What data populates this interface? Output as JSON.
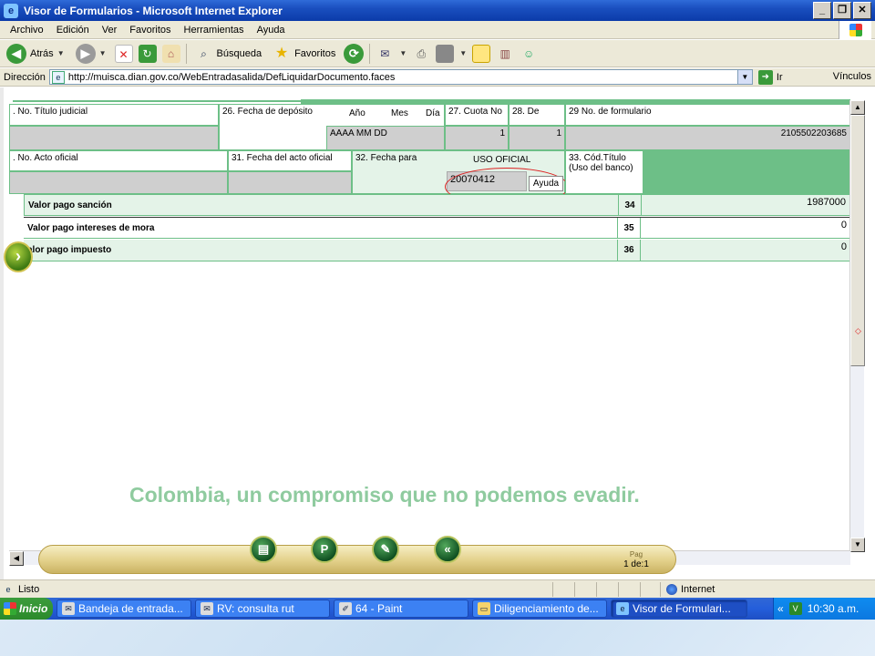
{
  "window": {
    "title": "Visor de Formularios - Microsoft Internet Explorer",
    "buttons": [
      "_",
      "❐",
      "✕"
    ]
  },
  "menu": {
    "items": [
      "Archivo",
      "Edición",
      "Ver",
      "Favoritos",
      "Herramientas",
      "Ayuda"
    ]
  },
  "toolbar": {
    "back_label": "Atrás",
    "search_label": "Búsqueda",
    "favorites_label": "Favoritos"
  },
  "address": {
    "label": "Dirección",
    "url": "http://muisca.dian.gov.co/WebEntradasalida/DefLiquidarDocumento.faces",
    "go_label": "Ir",
    "links_label": "Vínculos"
  },
  "form": {
    "f25_label": ". No. Título judicial",
    "f26_label": "26. Fecha de depósito",
    "year_label": "Año",
    "month_label": "Mes",
    "day_label": "Día",
    "f27_label": "27. Cuota No",
    "f28_label": "28. De",
    "f29_label": "29 No. de formulario",
    "date_format": "AAAA  MM  DD",
    "f27_value": "1",
    "f28_value": "1",
    "f29_value": "2105502203685",
    "f30_label": ". No. Acto oficial",
    "f31_label": "31. Fecha del acto oficial",
    "f32_label": "32. Fecha para",
    "uso_oficial": "USO OFICIAL",
    "f32_value": "20070412",
    "ayuda_label": "Ayuda",
    "f33_label_1": "33. Cód.Título",
    "f33_label_2": "(Uso del banco)"
  },
  "rows": [
    {
      "label": "Valor pago sanción",
      "num": "34",
      "value": "1987000"
    },
    {
      "label": "Valor pago intereses de mora",
      "num": "35",
      "value": "0"
    },
    {
      "label": "alor pago impuesto",
      "num": "36",
      "value": "0"
    }
  ],
  "slogan": "Colombia, un compromiso que no podemos evadir.",
  "nav": {
    "page_word": "Pag",
    "page_info": "1 de:1"
  },
  "status": {
    "text": "Listo",
    "zone": "Internet"
  },
  "taskbar": {
    "start": "Inicio",
    "tasks": [
      "Bandeja de entrada...",
      "RV: consulta rut",
      "64 - Paint",
      "Diligenciamiento de...",
      "Visor de Formulari..."
    ],
    "clock": "10:30 a.m."
  }
}
